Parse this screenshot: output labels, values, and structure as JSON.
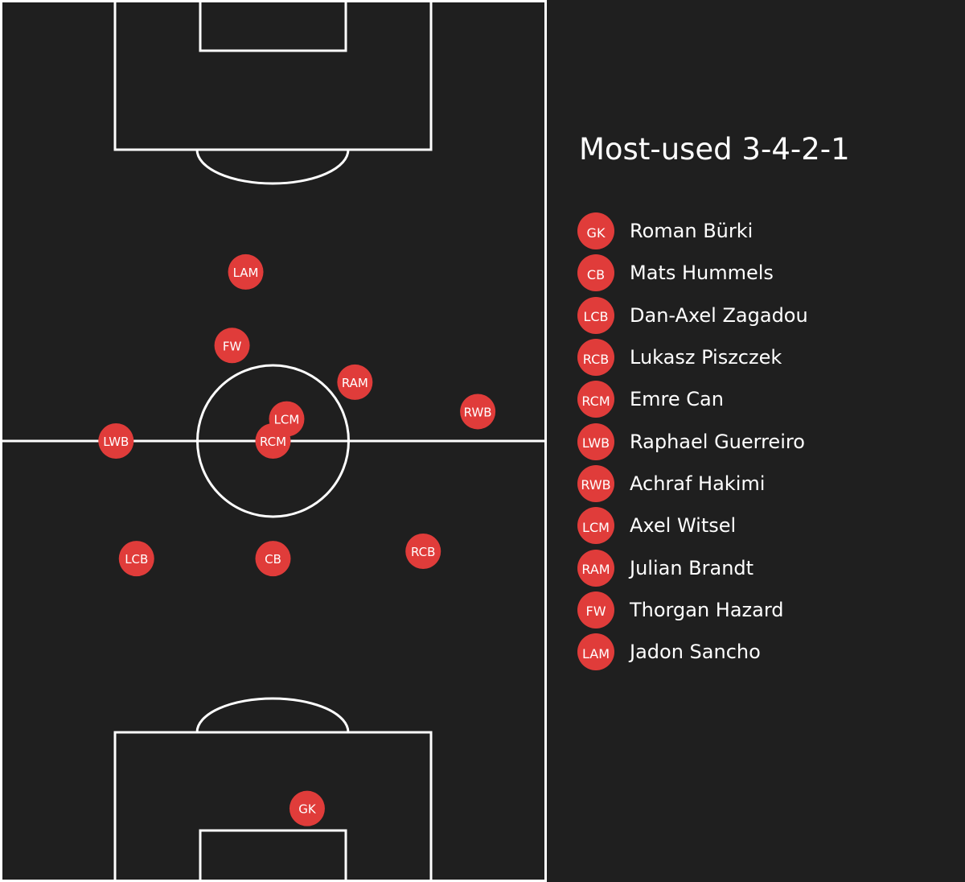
{
  "colors": {
    "background": "#1f1f1f",
    "pitch_lines": "#ffffff",
    "marker": "#e03c3a",
    "text": "#ffffff"
  },
  "panel": {
    "title": "Most-used 3-4-2-1"
  },
  "roster": [
    {
      "position": "GK",
      "name": "Roman Bürki"
    },
    {
      "position": "CB",
      "name": "Mats Hummels"
    },
    {
      "position": "LCB",
      "name": "Dan-Axel Zagadou"
    },
    {
      "position": "RCB",
      "name": "Lukasz Piszczek"
    },
    {
      "position": "RCM",
      "name": "Emre Can"
    },
    {
      "position": "LWB",
      "name": "Raphael Guerreiro"
    },
    {
      "position": "RWB",
      "name": "Achraf Hakimi"
    },
    {
      "position": "LCM",
      "name": "Axel Witsel"
    },
    {
      "position": "RAM",
      "name": "Julian Brandt"
    },
    {
      "position": "FW",
      "name": "Thorgan Hazard"
    },
    {
      "position": "LAM",
      "name": "Jadon Sancho"
    }
  ],
  "chart_data": {
    "type": "scatter",
    "pitch_dimensions": {
      "width": 80,
      "length": 120
    },
    "points": [
      {
        "label": "GK",
        "x": 45,
        "y": 10
      },
      {
        "label": "CB",
        "x": 40,
        "y": 44
      },
      {
        "label": "LCB",
        "x": 20,
        "y": 44
      },
      {
        "label": "RCB",
        "x": 62,
        "y": 45
      },
      {
        "label": "RCM",
        "x": 40,
        "y": 60
      },
      {
        "label": "LWB",
        "x": 17,
        "y": 60
      },
      {
        "label": "RWB",
        "x": 70,
        "y": 64
      },
      {
        "label": "LCM",
        "x": 42,
        "y": 63
      },
      {
        "label": "RAM",
        "x": 52,
        "y": 68
      },
      {
        "label": "FW",
        "x": 34,
        "y": 73
      },
      {
        "label": "LAM",
        "x": 36,
        "y": 83
      }
    ]
  }
}
